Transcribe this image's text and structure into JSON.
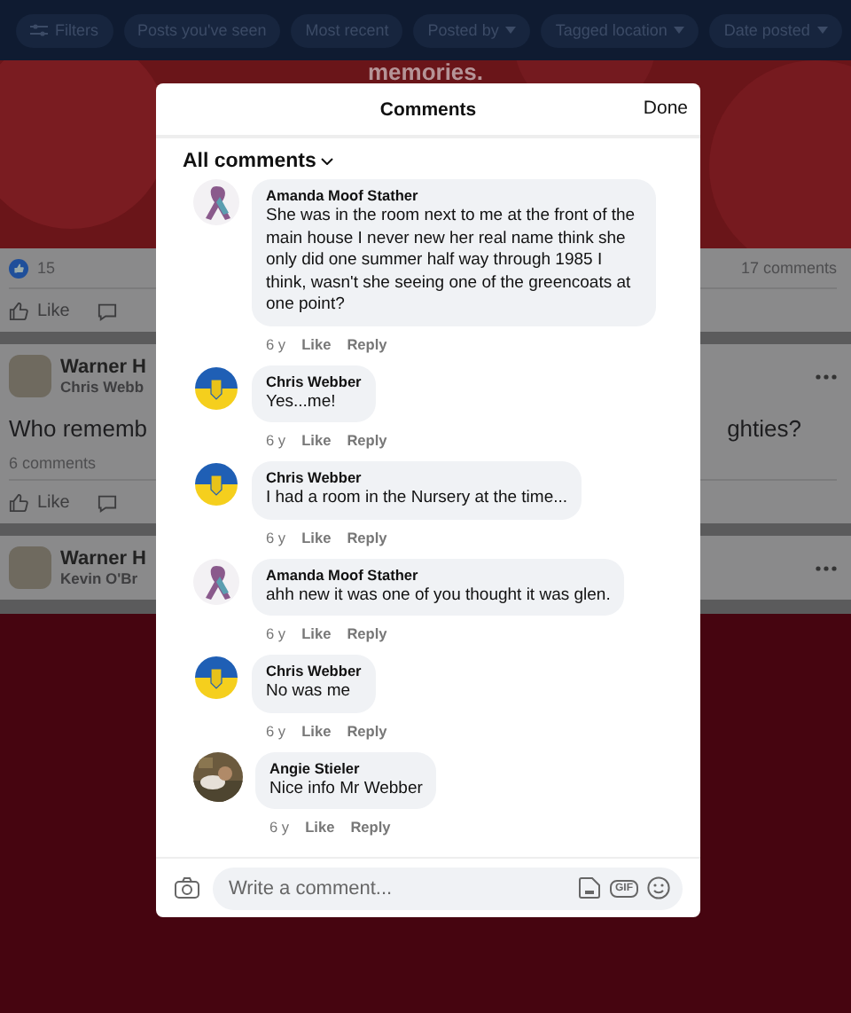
{
  "filter_bar": [
    {
      "label": "Filters",
      "kind": "filters"
    },
    {
      "label": "Posts you've seen",
      "kind": "plain"
    },
    {
      "label": "Most recent",
      "kind": "plain"
    },
    {
      "label": "Posted by",
      "kind": "dropdown"
    },
    {
      "label": "Tagged location",
      "kind": "dropdown"
    },
    {
      "label": "Date posted",
      "kind": "dropdown"
    }
  ],
  "banner": {
    "text": "memories."
  },
  "feed": {
    "reactions": "15",
    "comments_count": "17 comments",
    "like_label": "Like",
    "posts": [
      {
        "author": "Warner H",
        "subtitle": "Chris Webb",
        "text_start": "Who rememb",
        "text_end": "ghties?",
        "comments": "6 comments",
        "like_label": "Like"
      },
      {
        "author": "Warner H",
        "subtitle": "Kevin O'Br"
      }
    ]
  },
  "modal": {
    "title": "Comments",
    "done": "Done",
    "sort": "All comments",
    "comments": [
      {
        "author": "Amanda Moof Stather",
        "kind": "ribbon",
        "text": "She was in the room next to me at the front of the main house I never new her real name think she only did one summer half way through 1985 I think, wasn't she seeing one of the greencoats at one point?",
        "age": "6 y",
        "like": "Like",
        "reply": "Reply"
      },
      {
        "author": "Chris Webber",
        "kind": "flag",
        "text": "Yes...me!",
        "age": "6 y",
        "like": "Like",
        "reply": "Reply"
      },
      {
        "author": "Chris Webber",
        "kind": "flag",
        "text": "I had a room in the Nursery at the time...",
        "age": "6 y",
        "like": "Like",
        "reply": "Reply"
      },
      {
        "author": "Amanda Moof Stather",
        "kind": "ribbon",
        "text": "ahh new it was one of you thought it was glen.",
        "age": "6 y",
        "like": "Like",
        "reply": "Reply"
      },
      {
        "author": "Chris Webber",
        "kind": "flag",
        "text": "No was me",
        "age": "6 y",
        "like": "Like",
        "reply": "Reply"
      },
      {
        "author": "Angie Stieler",
        "text": "Nice info Mr Webber",
        "age": "6 y",
        "like": "Like",
        "reply": "Reply"
      }
    ],
    "composer": {
      "placeholder": "Write a comment...",
      "gif": "GIF"
    }
  }
}
